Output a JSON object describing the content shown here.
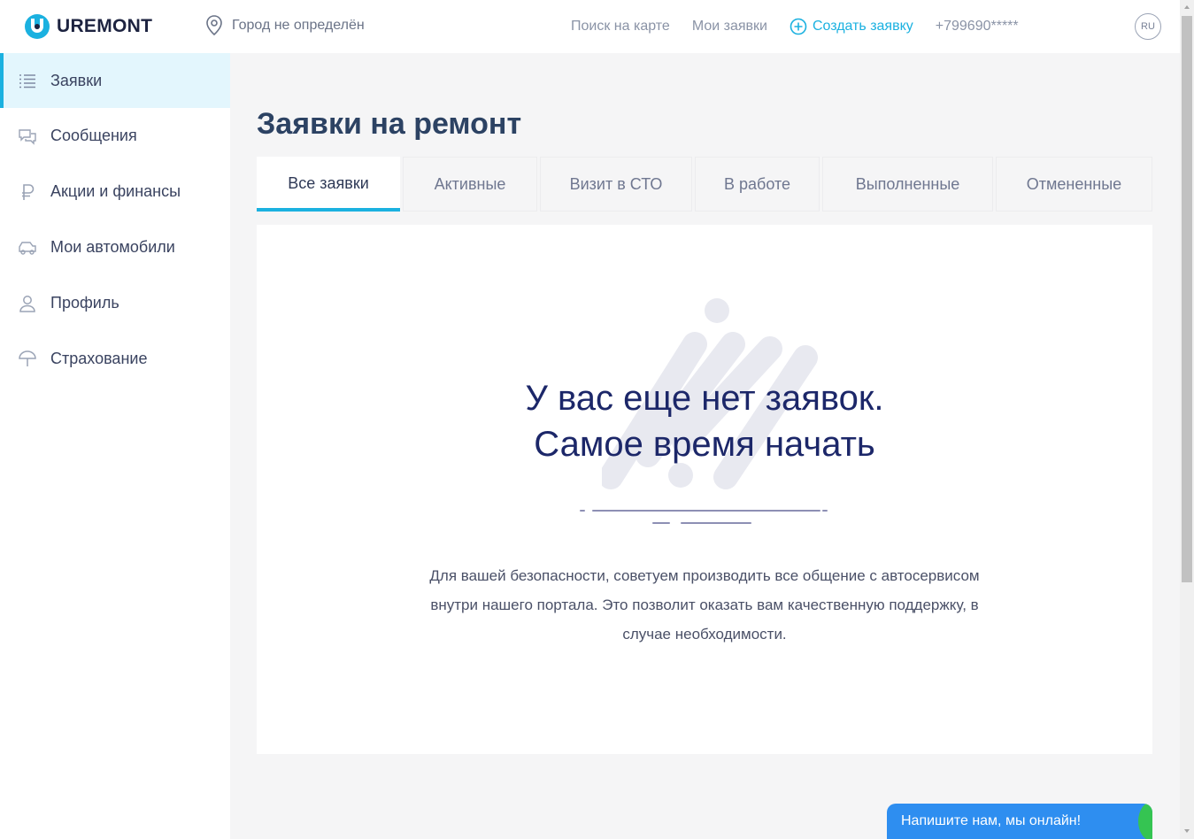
{
  "header": {
    "brand": "UREMONT",
    "city": "Город не определён",
    "nav": [
      "Поиск на карте",
      "Мои заявки"
    ],
    "create_label": "Создать заявку",
    "phone": "+799690*****",
    "lang": "RU"
  },
  "sidebar": {
    "items": [
      {
        "label": "Заявки",
        "icon": "list-icon"
      },
      {
        "label": "Сообщения",
        "icon": "chat-bubbles-icon"
      },
      {
        "label": "Акции и финансы",
        "icon": "ruble-icon"
      },
      {
        "label": "Мои автомобили",
        "icon": "car-icon"
      },
      {
        "label": "Профиль",
        "icon": "user-icon"
      },
      {
        "label": "Страхование",
        "icon": "umbrella-icon"
      }
    ]
  },
  "main": {
    "title": "Заявки на ремонт",
    "tabs": [
      "Все заявки",
      "Активные",
      "Визит в СТО",
      "В работе",
      "Выполненные",
      "Отмененные"
    ],
    "empty_line1": "У вас еще нет заявок.",
    "empty_line2": "Самое время начать",
    "note": "Для вашей безопасности, советуем производить все общение с автосервисом внутри нашего портала. Это позволит оказать вам качественную поддержку, в случае необходимости."
  },
  "chat": {
    "label": "Напишите нам, мы онлайн!"
  },
  "colors": {
    "accent": "#1bb1e0",
    "title": "#2c4263",
    "empty_title": "#1c2769",
    "chat": "#2e8ef0"
  }
}
